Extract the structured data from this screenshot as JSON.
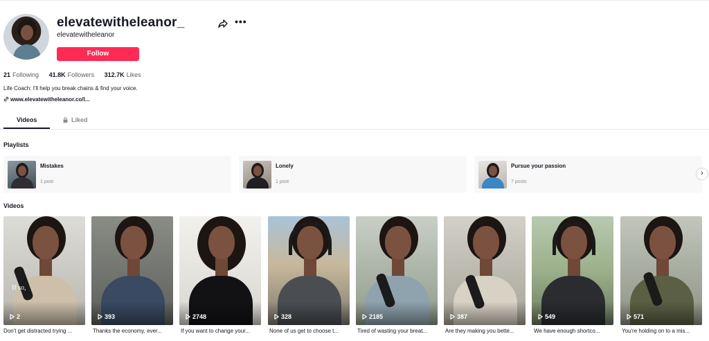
{
  "profile": {
    "username": "elevatewitheleanor_",
    "nickname": "elevatewitheleanor",
    "follow_label": "Follow",
    "more_label": "•••"
  },
  "stats": {
    "following_count": "21",
    "following_label": "Following",
    "followers_count": "41.8K",
    "followers_label": "Followers",
    "likes_count": "312.7K",
    "likes_label": "Likes"
  },
  "bio": "Life Coach: I'll help you break chains & find your voice.",
  "link": "www.elevatewitheleanor.co/l...",
  "tabs": {
    "videos": "Videos",
    "liked": "Liked"
  },
  "playlists_title": "Playlists",
  "playlists": [
    {
      "name": "Mistakes",
      "count": "1 post"
    },
    {
      "name": "Lonely",
      "count": "1 post"
    },
    {
      "name": "Pursue your passion",
      "count": "7 posts"
    }
  ],
  "next_label": "›",
  "videos_title": "Videos",
  "videos": [
    {
      "views": "2",
      "caption": "Don't get distracted trying ...",
      "overlay_text": "If so,"
    },
    {
      "views": "393",
      "caption": "Thanks the economy, ever..."
    },
    {
      "views": "2748",
      "caption": "If you want to change your..."
    },
    {
      "views": "328",
      "caption": "None of us get to choose t..."
    },
    {
      "views": "2185",
      "caption": "Tired of wasting your breat..."
    },
    {
      "views": "387",
      "caption": "Are they making you bette..."
    },
    {
      "views": "549",
      "caption": "We have enough shortco..."
    },
    {
      "views": "571",
      "caption": "You're holding on to a mis..."
    }
  ],
  "colors": {
    "accent": "#fe2c55",
    "text": "#161823",
    "muted": "#8a8b91"
  },
  "icons": {
    "share": "share-icon",
    "more": "more-icon",
    "link": "link-icon",
    "lock": "lock-icon",
    "play": "play-icon",
    "next": "chevron-right-icon"
  }
}
